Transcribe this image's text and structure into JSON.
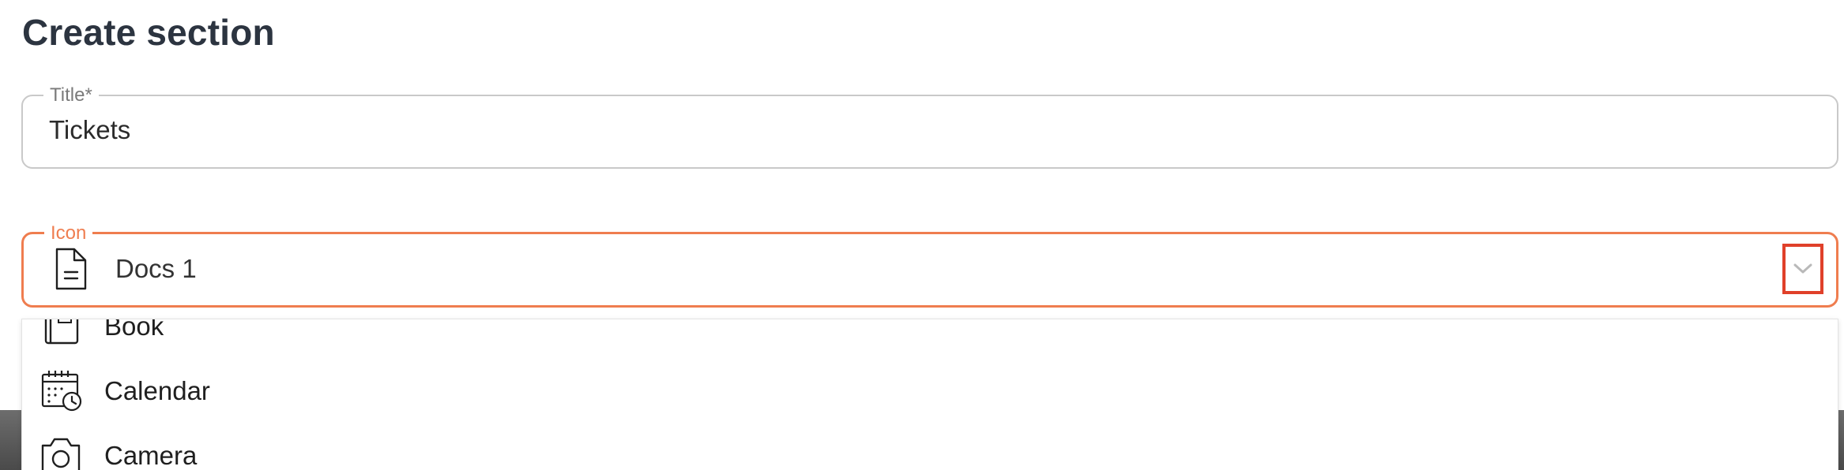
{
  "page": {
    "title": "Create section"
  },
  "title_field": {
    "label": "Title*",
    "value": "Tickets"
  },
  "icon_field": {
    "label": "Icon",
    "selected_icon": "docs-icon",
    "selected_value": "Docs 1",
    "accent_color": "#ef7d4f",
    "toggle_highlight_color": "#e0402a"
  },
  "icon_options": [
    {
      "icon": "book-icon",
      "label": "Book"
    },
    {
      "icon": "calendar-icon",
      "label": "Calendar"
    },
    {
      "icon": "camera-icon",
      "label": "Camera"
    }
  ]
}
